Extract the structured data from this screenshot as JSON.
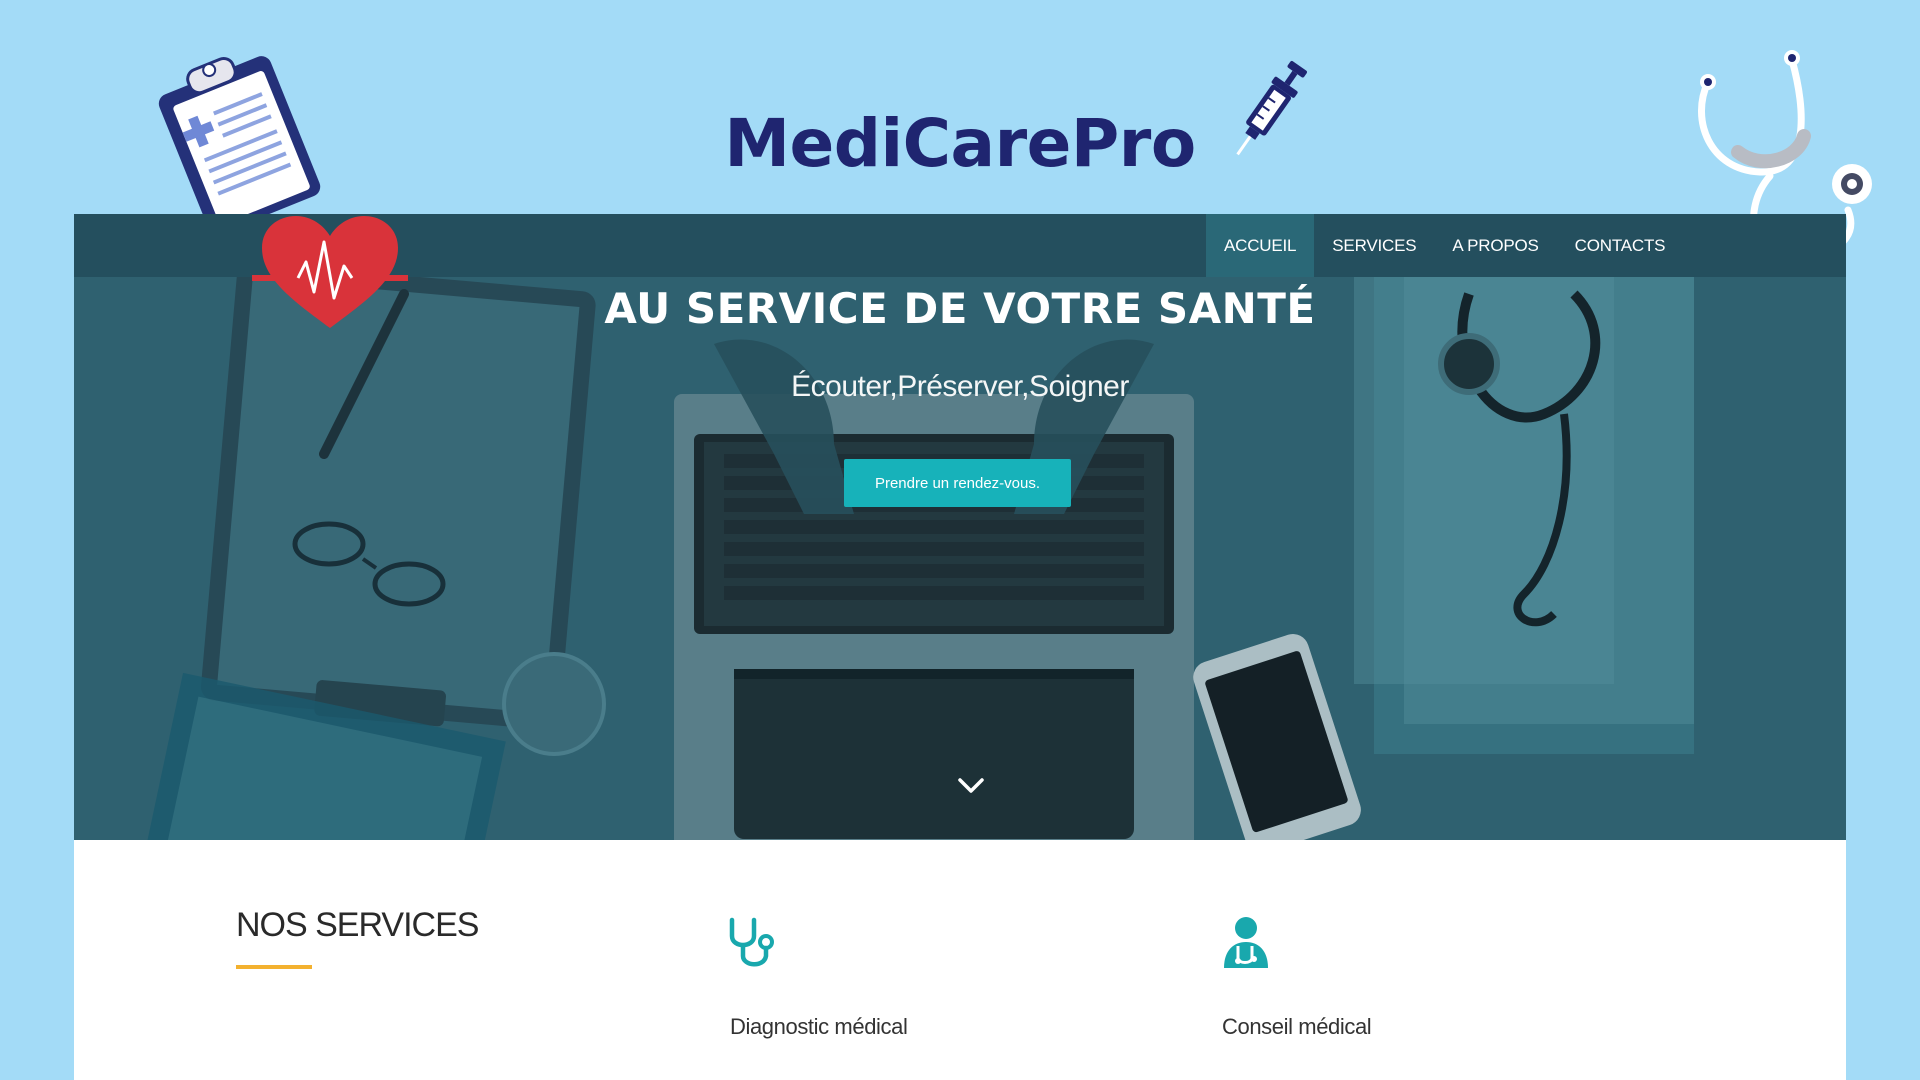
{
  "brand": {
    "title": "MediCarePro"
  },
  "nav": {
    "items": [
      {
        "label": "ACCUEIL",
        "active": true
      },
      {
        "label": "SERVICES",
        "active": false
      },
      {
        "label": "A PROPOS",
        "active": false
      },
      {
        "label": "CONTACTS",
        "active": false
      }
    ]
  },
  "hero": {
    "title": "AU SERVICE DE VOTRE SANTÉ",
    "subtitle": "Écouter,Préserver,Soigner",
    "cta_label": "Prendre un rendez-vous.",
    "scroll_icon": "chevron-down-icon"
  },
  "services": {
    "heading": "NOS SERVICES",
    "items": [
      {
        "label": "Diagnostic médical",
        "icon": "stethoscope-icon"
      },
      {
        "label": "Conseil médical",
        "icon": "doctor-icon"
      }
    ]
  },
  "colors": {
    "background": "#a3dbf7",
    "brand": "#1f2570",
    "navbar": "#244f5e",
    "hero_overlay": "#2f6170",
    "accent": "#17b2ba",
    "underline": "#f3b12f",
    "heart": "#d9333a"
  }
}
